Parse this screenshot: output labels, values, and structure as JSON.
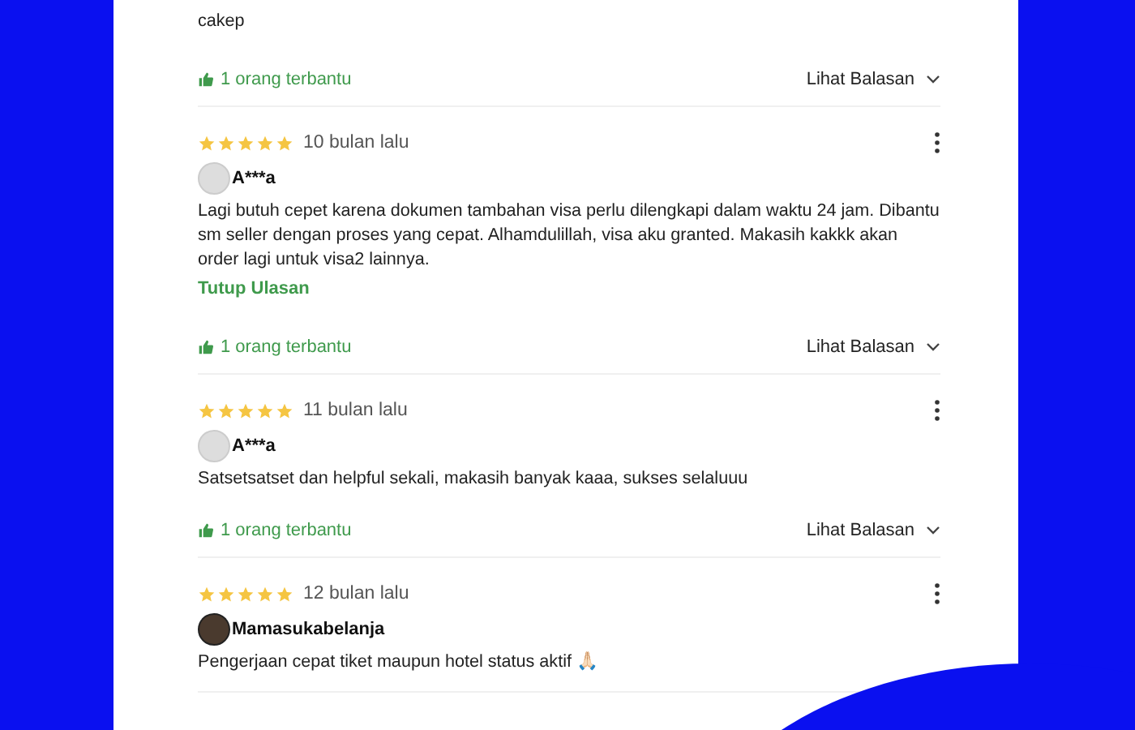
{
  "reviews": [
    {
      "kind": "continued",
      "text": "cakep",
      "helpful": "1 orang terbantu",
      "replies": "Lihat Balasan"
    },
    {
      "kind": "default",
      "stars": 5,
      "time": "10 bulan lalu",
      "name": "A***a",
      "text": "Lagi butuh cepet karena dokumen tambahan visa perlu dilengkapi dalam waktu 24 jam. Dibantu sm seller dengan proses yang cepat. Alhamdulillah, visa aku granted. Makasih kakkk akan order lagi untuk visa2 lainnya.",
      "collapse": "Tutup Ulasan",
      "helpful": "1 orang terbantu",
      "replies": "Lihat Balasan"
    },
    {
      "kind": "default",
      "stars": 5,
      "time": "11 bulan lalu",
      "name": "A***a",
      "text": "Satsetsatset dan helpful sekali, makasih banyak kaaa, sukses selaluuu",
      "helpful": "1 orang terbantu",
      "replies": "Lihat Balasan"
    },
    {
      "kind": "photo",
      "stars": 5,
      "time": "12 bulan lalu",
      "name": "Mamasukabelanja",
      "text": "Pengerjaan cepat tiket maupun hotel status aktif 🙏🏻"
    }
  ]
}
